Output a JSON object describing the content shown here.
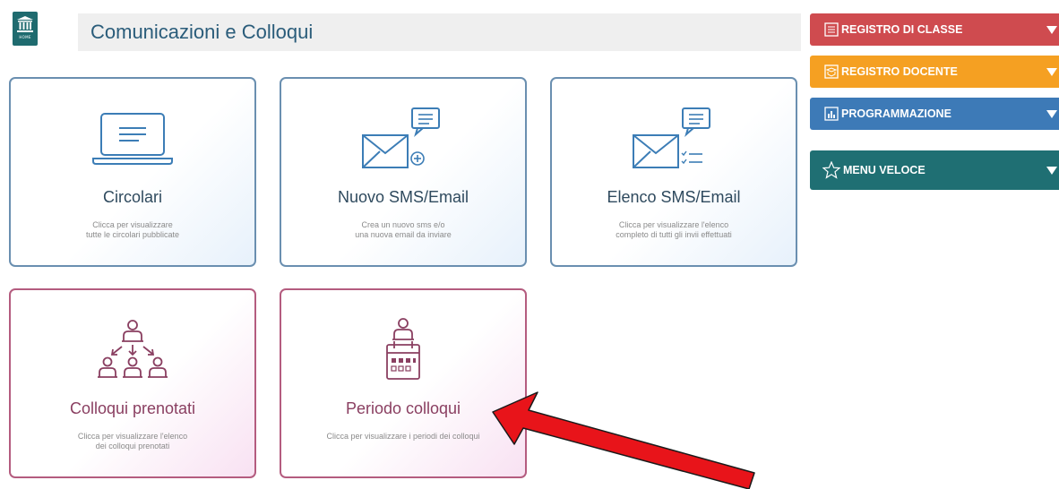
{
  "home": {
    "label": "HOME"
  },
  "header": {
    "title": "Comunicazioni e Colloqui"
  },
  "cards": [
    {
      "title": "Circolari",
      "description": "Clicca per visualizzare\ntutte le circolari pubblicate",
      "icon": "laptop-icon"
    },
    {
      "title": "Nuovo SMS/Email",
      "description": "Crea un nuovo sms e/o\nuna nuova email da inviare",
      "icon": "new-message-icon"
    },
    {
      "title": "Elenco SMS/Email",
      "description": "Clicca per visualizzare l'elenco\ncompleto di tutti gli invii effettuati",
      "icon": "message-list-icon"
    },
    {
      "title": "Colloqui prenotati",
      "description": "Clicca per visualizzare l'elenco\ndei colloqui prenotati",
      "icon": "people-hierarchy-icon"
    },
    {
      "title": "Periodo colloqui",
      "description": "Clicca per visualizzare i periodi dei colloqui",
      "icon": "calendar-person-icon"
    }
  ],
  "menu": [
    {
      "label": "REGISTRO DI CLASSE",
      "color": "#cf4b4f",
      "icon": "list-icon"
    },
    {
      "label": "REGISTRO DOCENTE",
      "color": "#f5a022",
      "icon": "book-icon"
    },
    {
      "label": "PROGRAMMAZIONE",
      "color": "#3d7ab7",
      "icon": "chart-icon"
    },
    {
      "label": "MENU VELOCE",
      "color": "#1f6f73",
      "icon": "star-icon"
    }
  ],
  "colors": {
    "accent_blue": "#6a8fb0",
    "accent_pink": "#b45c7f",
    "arrow": "#e8141a"
  }
}
